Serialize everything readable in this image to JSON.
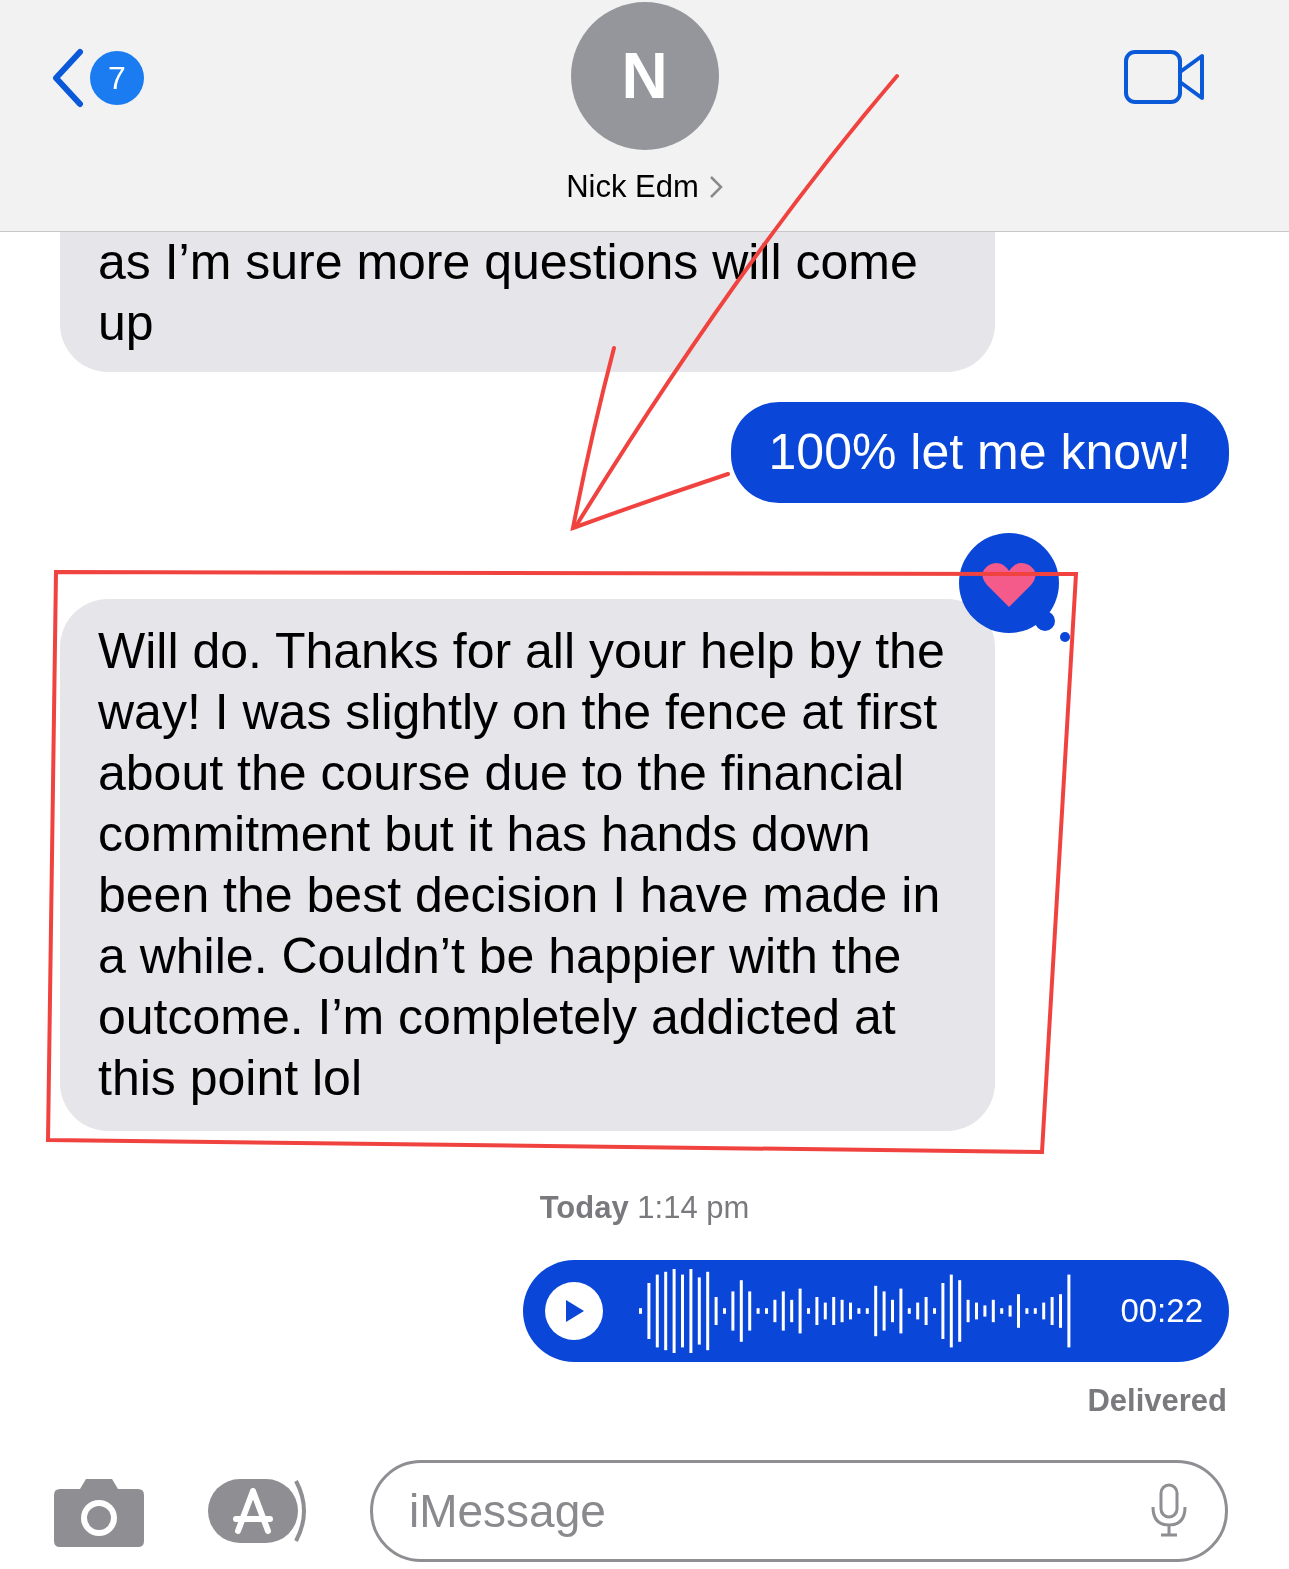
{
  "header": {
    "back_badge": "7",
    "avatar_initial": "N",
    "contact_name": "Nick Edm"
  },
  "messages": [
    {
      "kind": "text",
      "sent": false,
      "cut_top": true,
      "text": "as I’m sure more questions will come up",
      "hearted": false
    },
    {
      "kind": "text",
      "sent": true,
      "cut_top": false,
      "text": "100% let me know!",
      "hearted": false
    },
    {
      "kind": "text",
      "sent": false,
      "cut_top": false,
      "text": "Will do. Thanks for all your help by the way! I was slightly on the fence at first about the course due to the financial commitment but it has hands down been the best decision I have made in a while. Couldn’t be happier with the outcome. I’m completely addicted at this point lol",
      "hearted": true
    },
    {
      "kind": "timestamp",
      "text": "**Today** 1:14 pm"
    },
    {
      "kind": "audio",
      "sent": true,
      "duration": "00:22"
    },
    {
      "kind": "status",
      "text": "Delivered"
    }
  ],
  "composer": {
    "placeholder": "iMessage"
  }
}
